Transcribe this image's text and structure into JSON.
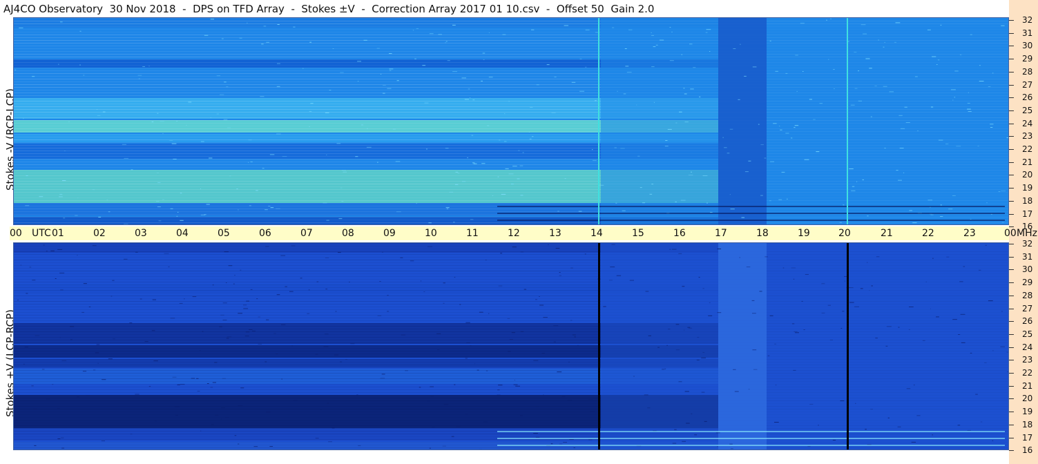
{
  "title": "AJ4CO Observatory  30 Nov 2018  -  DPS on TFD Array  -  Stokes ±V  -  Correction Array 2017 01 10.csv  -  Offset 50  Gain 2.0",
  "panels": {
    "top": {
      "label": "Stokes -V (RCP-LCP)"
    },
    "bottom": {
      "label": "Stokes +V (LCP-RCP)"
    }
  },
  "time_axis": {
    "labels": [
      "00",
      "UTC",
      "01",
      "02",
      "03",
      "04",
      "05",
      "06",
      "07",
      "08",
      "09",
      "10",
      "11",
      "12",
      "13",
      "14",
      "15",
      "16",
      "17",
      "18",
      "19",
      "20",
      "21",
      "22",
      "23",
      "00",
      "MHz"
    ]
  },
  "freq_axis": {
    "labels": [
      "32",
      "31",
      "30",
      "29",
      "28",
      "27",
      "26",
      "25",
      "24",
      "23",
      "22",
      "21",
      "20",
      "19",
      "18",
      "17",
      "16"
    ]
  },
  "colors": {
    "top_base": "#1e88e6",
    "bottom_base": "#1a48c8",
    "timebar": "#fffdc8",
    "right_strip": "#fde2c4"
  }
}
